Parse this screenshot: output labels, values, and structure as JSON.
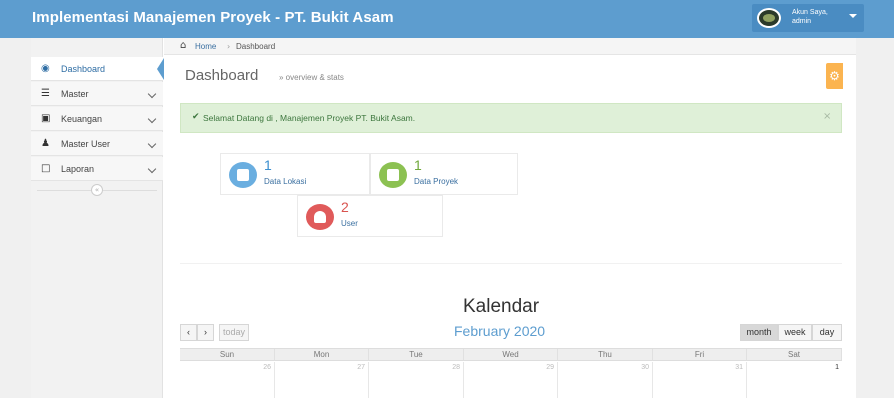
{
  "header": {
    "title": "Implementasi Manajemen Proyek - PT. Bukit Asam",
    "user_line1": "Akun Saya,",
    "user_line2": "admin",
    "brand_color": "#5d9dcf"
  },
  "sidebar": {
    "items": [
      {
        "label": "Dashboard",
        "icon": "dashboard-icon"
      },
      {
        "label": "Master",
        "icon": "list-icon"
      },
      {
        "label": "Keuangan",
        "icon": "money-icon"
      },
      {
        "label": "Master User",
        "icon": "user-icon"
      },
      {
        "label": "Laporan",
        "icon": "file-icon"
      }
    ],
    "collapse_symbol": "«"
  },
  "breadcrumb": {
    "home": "Home",
    "separator": "›",
    "current": "Dashboard"
  },
  "page": {
    "title": "Dashboard",
    "subtitle": "» overview & stats"
  },
  "alert": {
    "message": "Selamat Datang di , Manajemen Proyek PT. Bukit Asam.",
    "close": "×",
    "color": "#dff0d8"
  },
  "stats": [
    {
      "value": "1",
      "label": "Data Lokasi",
      "color": "#6aaee0"
    },
    {
      "value": "1",
      "label": "Data Proyek",
      "color": "#8cc152"
    },
    {
      "value": "2",
      "label": "User",
      "color": "#e05a5a"
    }
  ],
  "calendar": {
    "title": "Kalendar",
    "month": "February 2020",
    "prev": "‹",
    "next": "›",
    "today": "today",
    "views": [
      "month",
      "week",
      "day"
    ],
    "weekdays": [
      "Sun",
      "Mon",
      "Tue",
      "Wed",
      "Thu",
      "Fri",
      "Sat"
    ],
    "first_week": [
      "26",
      "27",
      "28",
      "29",
      "30",
      "31",
      "1"
    ]
  }
}
